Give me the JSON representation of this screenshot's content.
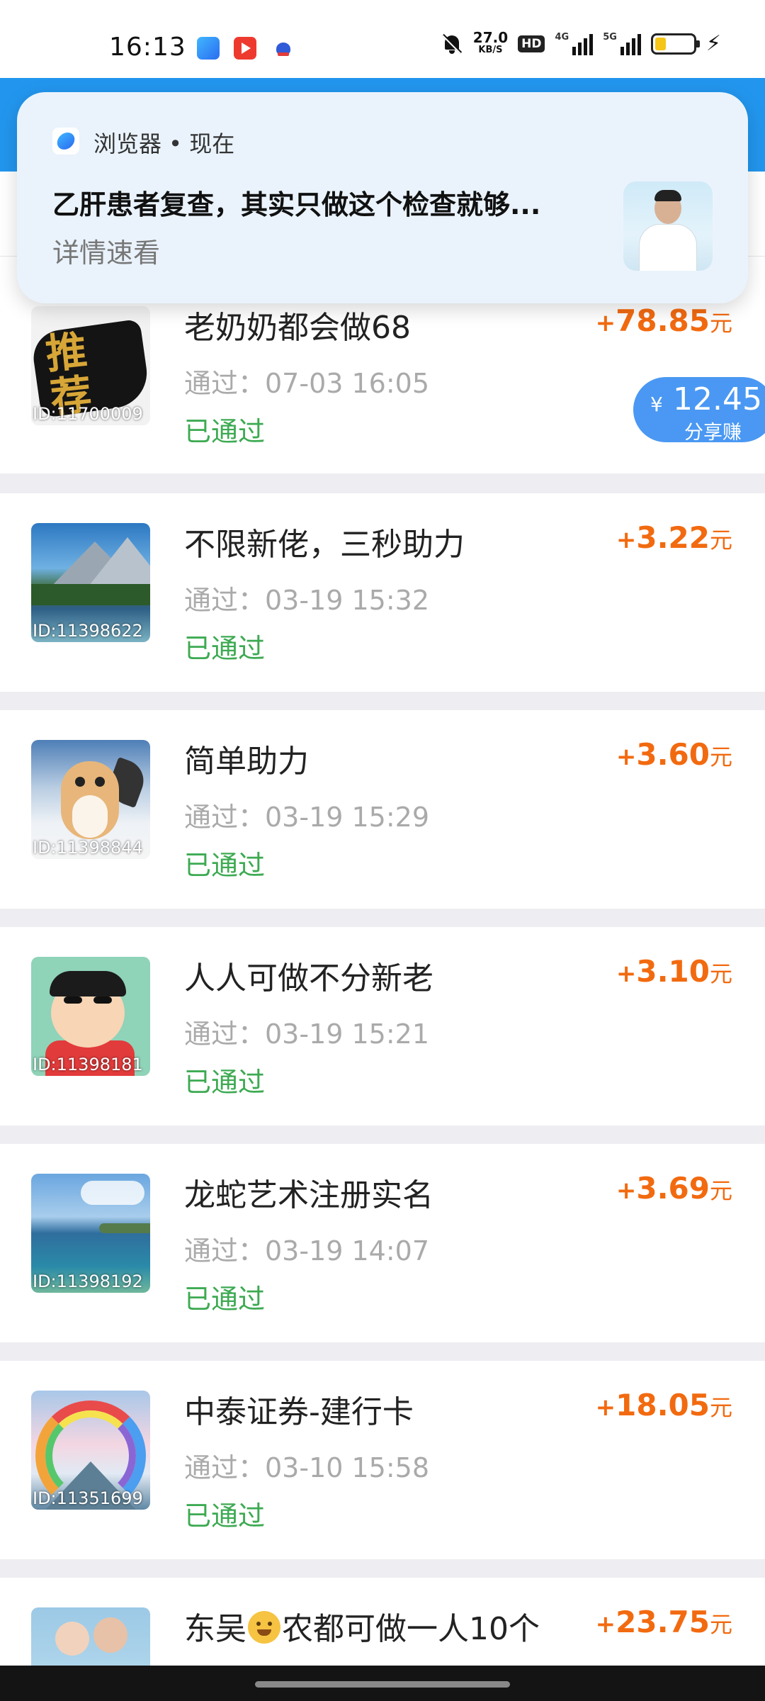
{
  "status_bar": {
    "time": "16:13",
    "net_speed_value": "27.0",
    "net_speed_unit": "KB/S",
    "hd_label": "HD",
    "signal1_label": "4G",
    "signal2_label": "5G",
    "icons": [
      "browser-app-icon",
      "video-app-icon",
      "baidu-app-icon",
      "mute-bell-icon",
      "hd-icon",
      "signal-4g-icon",
      "signal-5g-icon",
      "battery-icon",
      "charging-icon"
    ]
  },
  "notification": {
    "source": "浏览器 • 现在",
    "title": "乙肝患者复查，其实只做这个检查就够...",
    "subtitle": "详情速看"
  },
  "floating_badge": {
    "currency": "¥",
    "value": "12.45",
    "label": "分享赚"
  },
  "tasks": [
    {
      "id": "ID:11700009",
      "title": "老奶奶都会做68",
      "time": "通过：07-03 16:05",
      "status": "已通过",
      "amount": "78.85",
      "plus": "+",
      "unit": "元"
    },
    {
      "id": "ID:11398622",
      "title": "不限新佬，三秒助力",
      "time": "通过：03-19 15:32",
      "status": "已通过",
      "amount": "3.22",
      "plus": "+",
      "unit": "元"
    },
    {
      "id": "ID:11398844",
      "title": "简单助力",
      "time": "通过：03-19 15:29",
      "status": "已通过",
      "amount": "3.60",
      "plus": "+",
      "unit": "元"
    },
    {
      "id": "ID:11398181",
      "title": "人人可做不分新老",
      "time": "通过：03-19 15:21",
      "status": "已通过",
      "amount": "3.10",
      "plus": "+",
      "unit": "元"
    },
    {
      "id": "ID:11398192",
      "title": "龙蛇艺术注册实名",
      "time": "通过：03-19 14:07",
      "status": "已通过",
      "amount": "3.69",
      "plus": "+",
      "unit": "元"
    },
    {
      "id": "ID:11351699",
      "title": "中泰证券-建行卡",
      "time": "通过：03-10 15:58",
      "status": "已通过",
      "amount": "18.05",
      "plus": "+",
      "unit": "元"
    },
    {
      "title_before": "东吴",
      "title_after": "农都可做一人10个",
      "amount": "23.75",
      "plus": "+",
      "unit": "元"
    }
  ],
  "colors": {
    "accent_blue": "#2296ee",
    "amount_orange": "#f26a10",
    "status_green": "#3daa52"
  }
}
